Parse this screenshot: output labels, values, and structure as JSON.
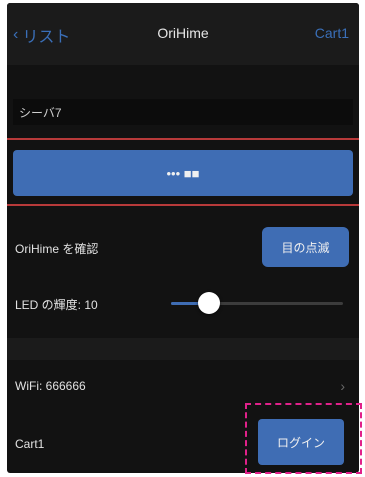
{
  "nav": {
    "back_label": "リスト",
    "title": "OriHime",
    "right_label": "Cart1"
  },
  "robot": {
    "name_field_value": "シーバ7",
    "primary_button_label": "••• ■■",
    "identify_label": "OriHime を確認",
    "blink_button_label": "目の点滅",
    "led_label": "LED の輝度: 10",
    "led_level_fraction": 0.22
  },
  "connection": {
    "wifi_label": "WiFi: 666666",
    "cart_label": "Cart1",
    "login_button_label": "ログイン"
  },
  "colors": {
    "accent": "#3f6db4",
    "divider_red": "#b83a3a",
    "highlight_magenta": "#e0218a"
  }
}
